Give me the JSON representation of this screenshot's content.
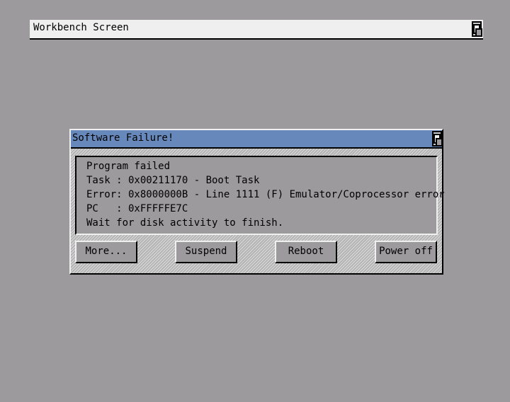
{
  "screen": {
    "title": "Workbench Screen"
  },
  "dialog": {
    "title": "Software Failure!",
    "message_lines": [
      "Program failed",
      "Task : 0x00211170 - Boot Task",
      "Error: 0x8000000B - Line 1111 (F) Emulator/Coprocessor error",
      "PC   : 0xFFFFFE7C",
      "Wait for disk activity to finish."
    ],
    "buttons": {
      "more": "More...",
      "suspend": "Suspend",
      "reboot": "Reboot",
      "power_off": "Power off"
    }
  },
  "colors": {
    "desktop": "#9c9a9c",
    "titlebar_active": "#6688bb",
    "screen_bar": "#efefef"
  },
  "icons": {
    "depth_gadget": "depth-arrange-icon"
  }
}
